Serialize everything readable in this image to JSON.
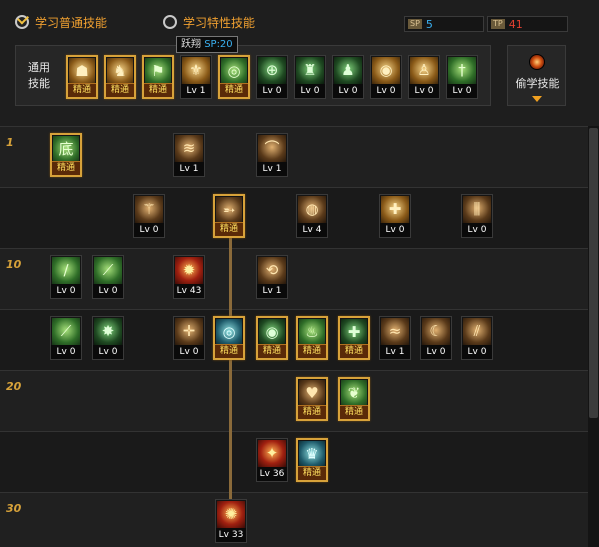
{
  "header": {
    "tab_normal": "学习普通技能",
    "tab_special": "学习特性技能",
    "sp_tag": "SP",
    "sp_value": "5",
    "tp_tag": "TP",
    "tp_value": "41"
  },
  "common": {
    "label": "通用技能",
    "steal_label": "偷学技能"
  },
  "tooltip": {
    "name": "跃翔",
    "sp": "SP:20"
  },
  "colors": {
    "accent": "#f0a030",
    "master_border": "#d7a23a",
    "sp_blue": "#3ab0f0",
    "tp_red": "#e04030"
  },
  "common_skills": [
    {
      "badge": "精通",
      "icon": "kneeling-figure-icon",
      "glyph": "☗",
      "color": "c-gold",
      "master": true
    },
    {
      "badge": "精通",
      "icon": "leaping-figure-icon",
      "glyph": "♞",
      "color": "c-gold",
      "master": true
    },
    {
      "badge": "精通",
      "icon": "running-figure-icon",
      "glyph": "⚑",
      "color": "c-green",
      "master": true
    },
    {
      "badge": "Lv 1",
      "icon": "wings-icon",
      "glyph": "⚜",
      "color": "c-gold",
      "master": false
    },
    {
      "badge": "精通",
      "icon": "target-icon",
      "glyph": "◎",
      "color": "c-green",
      "master": true
    },
    {
      "badge": "Lv 0",
      "icon": "crosshair-icon",
      "glyph": "⊕",
      "color": "c-dgreen",
      "master": false
    },
    {
      "badge": "Lv 0",
      "icon": "fighter-icon",
      "glyph": "♜",
      "color": "c-dgreen",
      "master": false
    },
    {
      "badge": "Lv 0",
      "icon": "charging-figure-icon",
      "glyph": "♟",
      "color": "c-dgreen",
      "master": false
    },
    {
      "badge": "Lv 0",
      "icon": "eye-icon",
      "glyph": "◉",
      "color": "c-gold",
      "master": false
    },
    {
      "badge": "Lv 0",
      "icon": "praying-figure-icon",
      "glyph": "♙",
      "color": "c-gold",
      "master": false
    },
    {
      "badge": "Lv 0",
      "icon": "dagger-figure-icon",
      "glyph": "†",
      "color": "c-green",
      "master": false
    }
  ],
  "tree": {
    "levels": [
      "1",
      "10",
      "20",
      "30"
    ],
    "skills": [
      {
        "badge": "精通",
        "icon": "low-stance-icon",
        "glyph": "底",
        "color": "c-green",
        "master": true
      },
      {
        "badge": "Lv 1",
        "icon": "claw-slash-icon",
        "glyph": "≋",
        "color": "c-brown",
        "master": false
      },
      {
        "badge": "Lv 1",
        "icon": "arc-slash-icon",
        "glyph": "⌒",
        "color": "c-brown",
        "master": false
      },
      {
        "badge": "Lv 0",
        "icon": "spread-blades-icon",
        "glyph": "⚚",
        "color": "c-brown",
        "master": false
      },
      {
        "badge": "精通",
        "icon": "arrow-strike-icon",
        "glyph": "➵",
        "color": "c-brown",
        "master": true
      },
      {
        "badge": "Lv 4",
        "icon": "spiral-icon",
        "glyph": "◍",
        "color": "c-brown",
        "master": false
      },
      {
        "badge": "Lv 0",
        "icon": "shield-cross-icon",
        "glyph": "✚",
        "color": "c-gold",
        "master": false
      },
      {
        "badge": "Lv 0",
        "icon": "triple-blade-icon",
        "glyph": "⫼",
        "color": "c-brown",
        "master": false
      },
      {
        "badge": "Lv 0",
        "icon": "green-slash-icon",
        "glyph": "∕",
        "color": "c-green",
        "master": false
      },
      {
        "badge": "Lv 0",
        "icon": "green-blade-icon",
        "glyph": "⟋",
        "color": "c-green",
        "master": false
      },
      {
        "badge": "Lv 43",
        "icon": "fire-burst-icon",
        "glyph": "✹",
        "color": "c-red",
        "master": false
      },
      {
        "badge": "Lv 1",
        "icon": "whirlwind-icon",
        "glyph": "⟲",
        "color": "c-brown",
        "master": false
      },
      {
        "badge": "Lv 0",
        "icon": "green-sword-icon",
        "glyph": "⟋",
        "color": "c-green",
        "master": false
      },
      {
        "badge": "Lv 0",
        "icon": "burst-star-icon",
        "glyph": "✸",
        "color": "c-dgreen",
        "master": false
      },
      {
        "badge": "Lv 0",
        "icon": "cross-slash-icon",
        "glyph": "✛",
        "color": "c-brown",
        "master": false
      },
      {
        "badge": "精通",
        "icon": "orb-icon",
        "glyph": "◎",
        "color": "c-teal",
        "master": true
      },
      {
        "badge": "精通",
        "icon": "green-orb-icon",
        "glyph": "◉",
        "color": "c-dgreen",
        "master": true
      },
      {
        "badge": "精通",
        "icon": "muscle-icon",
        "glyph": "♨",
        "color": "c-green",
        "master": true
      },
      {
        "badge": "精通",
        "icon": "green-cross-icon",
        "glyph": "✚",
        "color": "c-dgreen",
        "master": true
      },
      {
        "badge": "Lv 1",
        "icon": "sweep-icon",
        "glyph": "≈",
        "color": "c-brown",
        "master": false
      },
      {
        "badge": "Lv 0",
        "icon": "crescent-icon",
        "glyph": "☾",
        "color": "c-brown",
        "master": false
      },
      {
        "badge": "Lv 0",
        "icon": "flame-slash-icon",
        "glyph": "⫽",
        "color": "c-brown",
        "master": false
      },
      {
        "badge": "精通",
        "icon": "heart-shield-icon",
        "glyph": "♥",
        "color": "c-brown",
        "master": true
      },
      {
        "badge": "精通",
        "icon": "green-wings-icon",
        "glyph": "❦",
        "color": "c-green",
        "master": true
      },
      {
        "badge": "Lv 36",
        "icon": "blood-strike-icon",
        "glyph": "✦",
        "color": "c-red",
        "master": false
      },
      {
        "badge": "精通",
        "icon": "ice-figure-icon",
        "glyph": "♛",
        "color": "c-teal",
        "master": true
      },
      {
        "badge": "Lv 33",
        "icon": "explosion-icon",
        "glyph": "✺",
        "color": "c-red",
        "master": false
      }
    ]
  }
}
